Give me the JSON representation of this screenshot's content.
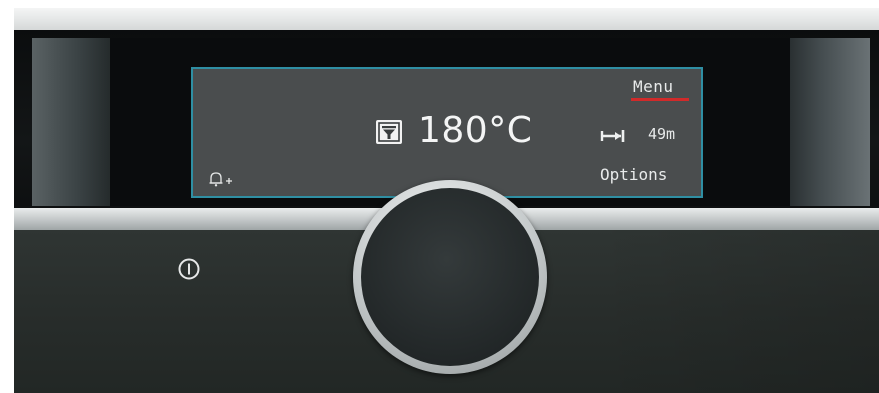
{
  "display": {
    "menu_label": "Menu",
    "temperature": "180°C",
    "temperature_mode_icon": "heating-mode-icon",
    "duration": "49m",
    "duration_icon": "duration-icon",
    "alarm_icon": "bell-add-icon",
    "options_label": "Options"
  },
  "controls": {
    "knob_icon": "control-knob",
    "power_icon": "power-icon"
  },
  "colors": {
    "display_border": "#2f8fa3",
    "menu_underline": "#d12a2a",
    "display_background": "#4a4d4e",
    "panel": "#2a2f2d"
  }
}
